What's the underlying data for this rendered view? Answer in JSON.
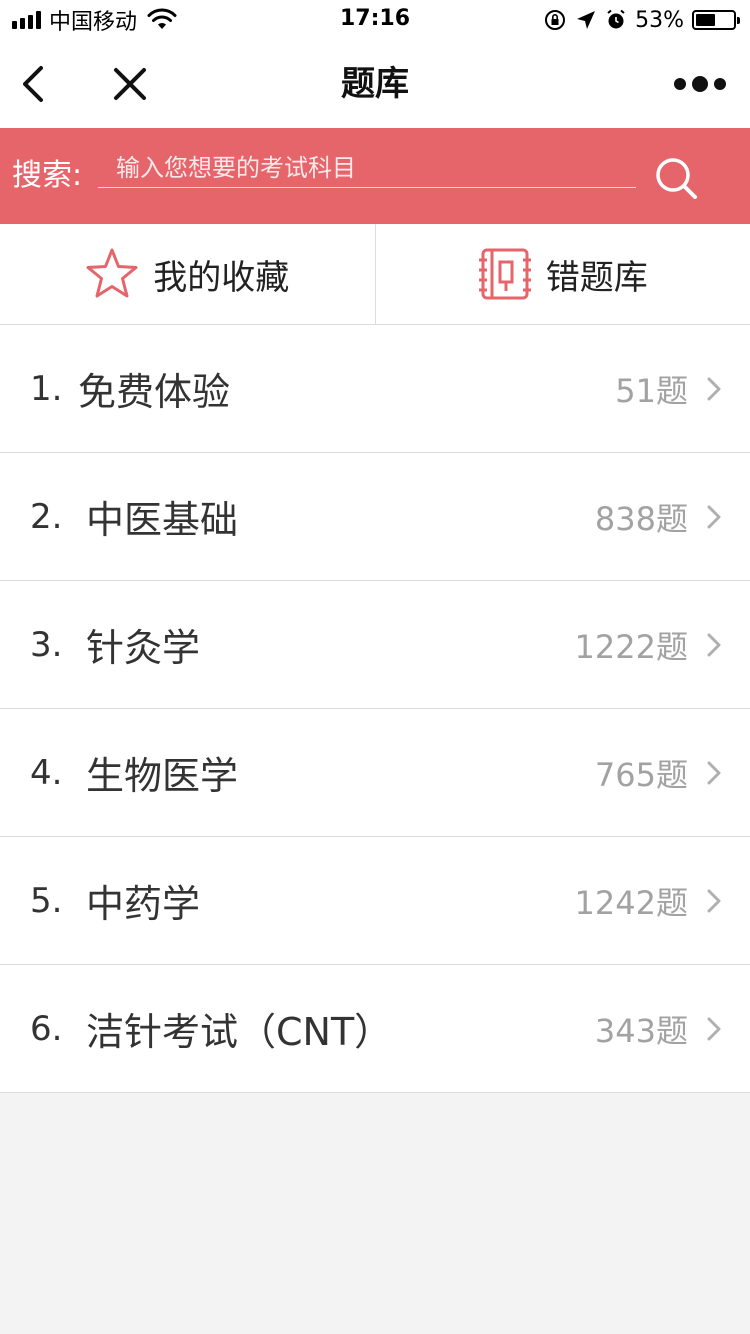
{
  "status_bar": {
    "carrier": "中国移动",
    "time": "17:16",
    "battery": "53%",
    "battery_level": 0.53,
    "icons": [
      "signal-icon",
      "wifi-icon",
      "rotation-lock-icon",
      "location-icon",
      "alarm-icon",
      "battery-icon"
    ]
  },
  "nav": {
    "title": "题库",
    "icons": [
      "back-icon",
      "close-icon",
      "more-icon"
    ]
  },
  "search": {
    "label": "搜索:",
    "placeholder": "输入您想要的考试科目",
    "icon": "search-icon"
  },
  "quick_tabs": [
    {
      "label": "我的收藏",
      "icon": "star-icon"
    },
    {
      "label": "错题库",
      "icon": "notebook-icon"
    }
  ],
  "subjects": [
    {
      "index": "1.",
      "name": "免费体验",
      "count": "51题"
    },
    {
      "index": "2.",
      "name": "中医基础",
      "count": "838题"
    },
    {
      "index": "3.",
      "name": "针灸学",
      "count": "1222题"
    },
    {
      "index": "4.",
      "name": "生物医学",
      "count": "765题"
    },
    {
      "index": "5.",
      "name": "中药学",
      "count": "1242题"
    },
    {
      "index": "6.",
      "name": "洁针考试（CNT）",
      "count": "343题"
    }
  ],
  "colors": {
    "accent": "#e5656b",
    "background": "#f3f3f3",
    "count_text": "#a2a2a2"
  }
}
